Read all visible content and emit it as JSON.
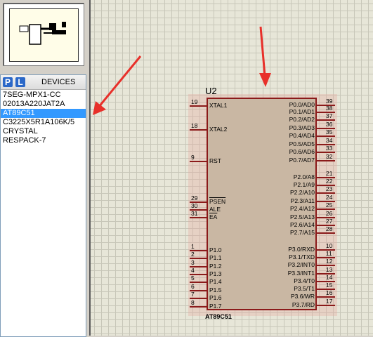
{
  "devices_panel": {
    "button_p": "P",
    "button_l": "L",
    "title": "DEVICES",
    "items": [
      "7SEG-MPX1-CC",
      "02013A220JAT2A",
      "AT89C51",
      "C3225X5R1A106K/5",
      "CRYSTAL",
      "RESPACK-7"
    ],
    "selected_index": 2
  },
  "schematic": {
    "ref": "U2",
    "part_name": "AT89C51",
    "left_pins": [
      {
        "num": "19",
        "label": "XTAL1"
      },
      {
        "num": "18",
        "label": "XTAL2"
      },
      {
        "num": "9",
        "label": "RST"
      },
      {
        "num": "29",
        "label": "PSEN"
      },
      {
        "num": "30",
        "label": "ALE"
      },
      {
        "num": "31",
        "label": "EA"
      },
      {
        "num": "1",
        "label": "P1.0"
      },
      {
        "num": "2",
        "label": "P1.1"
      },
      {
        "num": "3",
        "label": "P1.2"
      },
      {
        "num": "4",
        "label": "P1.3"
      },
      {
        "num": "5",
        "label": "P1.4"
      },
      {
        "num": "6",
        "label": "P1.5"
      },
      {
        "num": "7",
        "label": "P1.6"
      },
      {
        "num": "8",
        "label": "P1.7"
      }
    ],
    "right_pins": [
      {
        "num": "39",
        "label": "P0.0/AD0"
      },
      {
        "num": "38",
        "label": "P0.1/AD1"
      },
      {
        "num": "37",
        "label": "P0.2/AD2"
      },
      {
        "num": "36",
        "label": "P0.3/AD3"
      },
      {
        "num": "35",
        "label": "P0.4/AD4"
      },
      {
        "num": "34",
        "label": "P0.5/AD5"
      },
      {
        "num": "33",
        "label": "P0.6/AD6"
      },
      {
        "num": "32",
        "label": "P0.7/AD7"
      },
      {
        "num": "21",
        "label": "P2.0/A8"
      },
      {
        "num": "22",
        "label": "P2.1/A9"
      },
      {
        "num": "23",
        "label": "P2.2/A10"
      },
      {
        "num": "24",
        "label": "P2.3/A11"
      },
      {
        "num": "25",
        "label": "P2.4/A12"
      },
      {
        "num": "26",
        "label": "P2.5/A13"
      },
      {
        "num": "27",
        "label": "P2.6/A14"
      },
      {
        "num": "28",
        "label": "P2.7/A15"
      },
      {
        "num": "10",
        "label": "P3.0/RXD"
      },
      {
        "num": "11",
        "label": "P3.1/TXD"
      },
      {
        "num": "12",
        "label": "P3.2/INT0"
      },
      {
        "num": "13",
        "label": "P3.3/INT1"
      },
      {
        "num": "14",
        "label": "P3.4/T0"
      },
      {
        "num": "15",
        "label": "P3.5/T1"
      },
      {
        "num": "16",
        "label": "P3.6/WR"
      },
      {
        "num": "17",
        "label": "P3.7/RD"
      }
    ]
  },
  "colors": {
    "annotation_arrow": "#e8302a",
    "selection": "#3399ff",
    "pin": "#8b1a1a"
  }
}
